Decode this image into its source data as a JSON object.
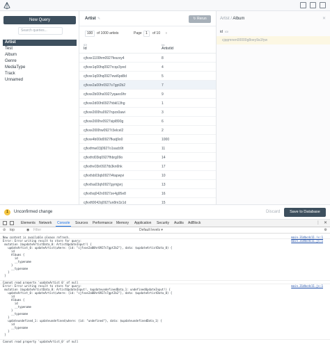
{
  "sidebar": {
    "new_query": "New Query",
    "search_placeholder": "Search queries...",
    "models": [
      "Artist",
      "Test",
      "Album",
      "Genre",
      "MediaType",
      "Track",
      "Unnamed"
    ],
    "active_model": "Artist"
  },
  "main": {
    "title": "Artist",
    "rerun": "Rerun",
    "pager": {
      "per_page": "100",
      "of_total": "of 1000 artists",
      "page_label": "Page",
      "page": "1",
      "of_pages": "of 10"
    },
    "columns": [
      {
        "type": "ID!",
        "name": "Id"
      },
      {
        "type": "Int",
        "name": "ArtistId"
      }
    ],
    "rows": [
      {
        "id": "cjfvxe1100hm0927feszxy4",
        "artistId": "8"
      },
      {
        "id": "cjfvxe1q00hq0927rcqz3yed",
        "artistId": "4"
      },
      {
        "id": "cjfvxe1q00hq0927ewi6pd8d",
        "artistId": "5"
      },
      {
        "id": "cjfvxe2a00hr0927s7gpt2b2",
        "artistId": "7"
      },
      {
        "id": "cjfvxe2b00hs0927yqaeo9hr",
        "artistId": "9"
      },
      {
        "id": "cjfvxe2d00ht0927hbkl13hg",
        "artistId": "1"
      },
      {
        "id": "cjfvxe2i00hu0927npzs0awi",
        "artistId": "3"
      },
      {
        "id": "cjfvxe2i00hv0927sipl890g",
        "artistId": "6"
      },
      {
        "id": "cjfvxe2l00hw0927r3elcel2",
        "artistId": "2"
      },
      {
        "id": "cjfvxe4b00id0927fkatj9o0",
        "artistId": "1000"
      },
      {
        "id": "cjfvxfmw03j0927o1sacb9t",
        "artistId": "11"
      },
      {
        "id": "cjfvxfrd03iq0927fhbrg09o",
        "artistId": "14"
      },
      {
        "id": "cjfvxfre03ir0927tb3kn6hk",
        "artistId": "17"
      },
      {
        "id": "cjfvxfsb03qb0927i4tapwjvi",
        "artistId": "10"
      },
      {
        "id": "cjfvxfsa03qh0927gymjjvrj",
        "artistId": "13"
      },
      {
        "id": "cjfvxfsq042n0927ze4g95e8",
        "artistId": "16"
      },
      {
        "id": "cjfvxft0042q0927un8m3z1d",
        "artistId": "15"
      }
    ],
    "selected_index": 3
  },
  "detail": {
    "model": "Artist",
    "sep": "/",
    "relation": "Album",
    "close": "✕",
    "field_name": "id",
    "field_type": "ID!",
    "placeholder": "cjqqmnen00000g8oey9a1fyw"
  },
  "unconfirmed": {
    "badge": "1",
    "text": "Unconfirmed change",
    "discard": "Discard",
    "save": "Save to Database"
  },
  "devtools": {
    "tabs": [
      "Elements",
      "Network",
      "Console",
      "Sources",
      "Performance",
      "Memory",
      "Application",
      "Security",
      "Audits",
      "AdBlock"
    ],
    "active_tab": "Console",
    "context": "top",
    "filter_placeholder": "Filter",
    "levels": "Default levels ▾",
    "source_link": "main.31dbcdc11.js:1",
    "console_lines": [
      "New content is available please refresh.",
      "Error: Error writing result to store for query:",
      " mutation ($updateArtistData_0: ArtistUpdateInput!) {",
      "   updateArtist_0: updateArtist(where: {id: \"cjfvxe2a00hr0927s7gpt2b2\"}, data: $updateArtistData_0) {",
      "     id",
      "     Albums {",
      "       id",
      "       __typename",
      "     }",
      "     __typename",
      "   }",
      " }",
      "",
      "Cannot read property 'updateArtist_0' of null",
      "Error: Error writing result to store for query:",
      " mutation ($updateArtistData_0: ArtistUpdateInput!, $updateundefinedData_1: undefinedUpdateInput!) {",
      "   updateArtist_0: updateArtist(where: {id: \"cjfvxe2a00hr0927s7gpt2b2\"}, data: $updateArtistData_0) {",
      "     id",
      "     Albums {",
      "       id",
      "       __typename",
      "     }",
      "     __typename",
      "   }",
      "   updateundefined_1: updateundefined(where: {id: \"undefined\"}, data: $updateundefinedData_1) {",
      "     id",
      "     __typename",
      "   }",
      " }",
      "",
      "Cannot read property 'updateArtist_0' of null"
    ]
  },
  "colors": {
    "accent": "#3d4f5e",
    "selected_row": "#eef3f8",
    "warning": "#f5c643",
    "placeholder_bg": "#fcf7e3"
  }
}
